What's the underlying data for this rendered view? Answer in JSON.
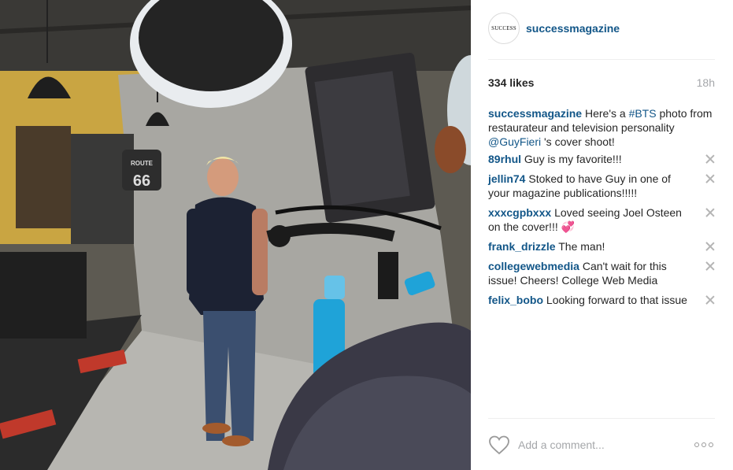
{
  "post": {
    "account": {
      "username": "successmagazine",
      "avatar_text": "SUCCESS"
    },
    "likes": "334 likes",
    "time_ago": "18h",
    "caption": {
      "username": "successmagazine",
      "text_1": "Here's a",
      "hashtag": "#BTS",
      "text_2": "photo from restaurateur and television personality",
      "mention": "@GuyFieri",
      "text_3": "'s cover shoot!"
    },
    "comments": [
      {
        "username": "89rhul",
        "text": "Guy is my favorite!!!"
      },
      {
        "username": "jellin74",
        "text": "Stoked to have Guy in one of your magazine publications!!!!!"
      },
      {
        "username": "xxxcgpbxxx",
        "text": "Loved seeing Joel Osteen on the cover!!! 💞"
      },
      {
        "username": "frank_drizzle",
        "text": "The man!"
      },
      {
        "username": "collegewebmedia",
        "text": "Can't wait for this issue! Cheers! College Web Media"
      },
      {
        "username": "felix_bobo",
        "text": "Looking forward to that issue"
      }
    ],
    "add_comment_placeholder": "Add a comment...",
    "photo_sign_text": "ROUTE 66",
    "colors": {
      "link": "#125688",
      "muted": "#a5a7aa",
      "divider": "#efefef"
    },
    "icons": {
      "like": "heart-outline-icon",
      "remove": "close-icon",
      "options": "ellipsis-icon"
    }
  }
}
